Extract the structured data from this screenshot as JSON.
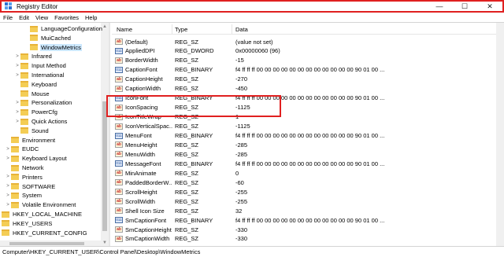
{
  "window": {
    "title": "Registry Editor",
    "controls": {
      "minimize": "—",
      "maximize": "☐",
      "close": "✕"
    }
  },
  "menu": [
    "File",
    "Edit",
    "View",
    "Favorites",
    "Help"
  ],
  "tree": [
    {
      "label": "LanguageConfiguration",
      "indent": 2,
      "expander": "",
      "selected": false
    },
    {
      "label": "MuiCached",
      "indent": 2,
      "expander": "",
      "selected": false
    },
    {
      "label": "WindowMetrics",
      "indent": 2,
      "expander": "",
      "selected": true
    },
    {
      "label": "Infrared",
      "indent": 1,
      "expander": ">",
      "selected": false
    },
    {
      "label": "Input Method",
      "indent": 1,
      "expander": ">",
      "selected": false
    },
    {
      "label": "International",
      "indent": 1,
      "expander": ">",
      "selected": false
    },
    {
      "label": "Keyboard",
      "indent": 1,
      "expander": "",
      "selected": false
    },
    {
      "label": "Mouse",
      "indent": 1,
      "expander": "",
      "selected": false
    },
    {
      "label": "Personalization",
      "indent": 1,
      "expander": ">",
      "selected": false
    },
    {
      "label": "PowerCfg",
      "indent": 1,
      "expander": ">",
      "selected": false
    },
    {
      "label": "Quick Actions",
      "indent": 1,
      "expander": ">",
      "selected": false
    },
    {
      "label": "Sound",
      "indent": 1,
      "expander": "",
      "selected": false
    },
    {
      "label": "Environment",
      "indent": 0,
      "expander": "",
      "selected": false
    },
    {
      "label": "EUDC",
      "indent": 0,
      "expander": ">",
      "selected": false
    },
    {
      "label": "Keyboard Layout",
      "indent": 0,
      "expander": ">",
      "selected": false
    },
    {
      "label": "Network",
      "indent": 0,
      "expander": "",
      "selected": false
    },
    {
      "label": "Printers",
      "indent": 0,
      "expander": ">",
      "selected": false
    },
    {
      "label": "SOFTWARE",
      "indent": 0,
      "expander": ">",
      "selected": false
    },
    {
      "label": "System",
      "indent": 0,
      "expander": ">",
      "selected": false
    },
    {
      "label": "Volatile Environment",
      "indent": 0,
      "expander": ">",
      "selected": false
    },
    {
      "label": "HKEY_LOCAL_MACHINE",
      "indent": -1,
      "expander": ">",
      "selected": false
    },
    {
      "label": "HKEY_USERS",
      "indent": -1,
      "expander": ">",
      "selected": false
    },
    {
      "label": "HKEY_CURRENT_CONFIG",
      "indent": -1,
      "expander": ">",
      "selected": false
    }
  ],
  "columns": {
    "name": "Name",
    "type": "Type",
    "data": "Data"
  },
  "values": [
    {
      "name": "(Default)",
      "type": "REG_SZ",
      "data": "(value not set)",
      "icon": "string"
    },
    {
      "name": "AppliedDPI",
      "type": "REG_DWORD",
      "data": "0x00000060 (96)",
      "icon": "binary"
    },
    {
      "name": "BorderWidth",
      "type": "REG_SZ",
      "data": "-15",
      "icon": "string"
    },
    {
      "name": "CaptionFont",
      "type": "REG_BINARY",
      "data": "f4 ff ff ff 00 00 00 00 00 00 00 00 00 00 00 00 90 01 00 ...",
      "icon": "binary"
    },
    {
      "name": "CaptionHeight",
      "type": "REG_SZ",
      "data": "-270",
      "icon": "string"
    },
    {
      "name": "CaptionWidth",
      "type": "REG_SZ",
      "data": "-450",
      "icon": "string"
    },
    {
      "name": "IconFont",
      "type": "REG_BINARY",
      "data": "f4 ff ff ff 00 00 00 00 00 00 00 00 00 00 00 00 90 01 00 ...",
      "icon": "binary"
    },
    {
      "name": "IconSpacing",
      "type": "REG_SZ",
      "data": "-1125",
      "icon": "string"
    },
    {
      "name": "IconTitleWrap",
      "type": "REG_SZ",
      "data": "1",
      "icon": "string"
    },
    {
      "name": "IconVerticalSpac...",
      "type": "REG_SZ",
      "data": "-1125",
      "icon": "string"
    },
    {
      "name": "MenuFont",
      "type": "REG_BINARY",
      "data": "f4 ff ff ff 00 00 00 00 00 00 00 00 00 00 00 00 90 01 00 ...",
      "icon": "binary"
    },
    {
      "name": "MenuHeight",
      "type": "REG_SZ",
      "data": "-285",
      "icon": "string"
    },
    {
      "name": "MenuWidth",
      "type": "REG_SZ",
      "data": "-285",
      "icon": "string"
    },
    {
      "name": "MessageFont",
      "type": "REG_BINARY",
      "data": "f4 ff ff ff 00 00 00 00 00 00 00 00 00 00 00 00 90 01 00 ...",
      "icon": "binary"
    },
    {
      "name": "MinAnimate",
      "type": "REG_SZ",
      "data": "0",
      "icon": "string"
    },
    {
      "name": "PaddedBorderW...",
      "type": "REG_SZ",
      "data": "-60",
      "icon": "string"
    },
    {
      "name": "ScrollHeight",
      "type": "REG_SZ",
      "data": "-255",
      "icon": "string"
    },
    {
      "name": "ScrollWidth",
      "type": "REG_SZ",
      "data": "-255",
      "icon": "string"
    },
    {
      "name": "Shell Icon Size",
      "type": "REG_SZ",
      "data": "32",
      "icon": "string"
    },
    {
      "name": "SmCaptionFont",
      "type": "REG_BINARY",
      "data": "f4 ff ff ff 00 00 00 00 00 00 00 00 00 00 00 00 90 01 00 ...",
      "icon": "binary"
    },
    {
      "name": "SmCaptionHeight",
      "type": "REG_SZ",
      "data": "-330",
      "icon": "string"
    },
    {
      "name": "SmCaptionWidth",
      "type": "REG_SZ",
      "data": "-330",
      "icon": "string"
    }
  ],
  "status": {
    "path": "Computer\\HKEY_CURRENT_USER\\Control Panel\\Desktop\\WindowMetrics"
  },
  "colors": {
    "highlight_border": "#e02020",
    "selection": "#cce8ff",
    "folder": "#f4cd55"
  },
  "icons": {
    "app": "registry-icon",
    "string": "string-value-icon",
    "binary": "binary-value-icon",
    "folder": "folder-icon"
  }
}
